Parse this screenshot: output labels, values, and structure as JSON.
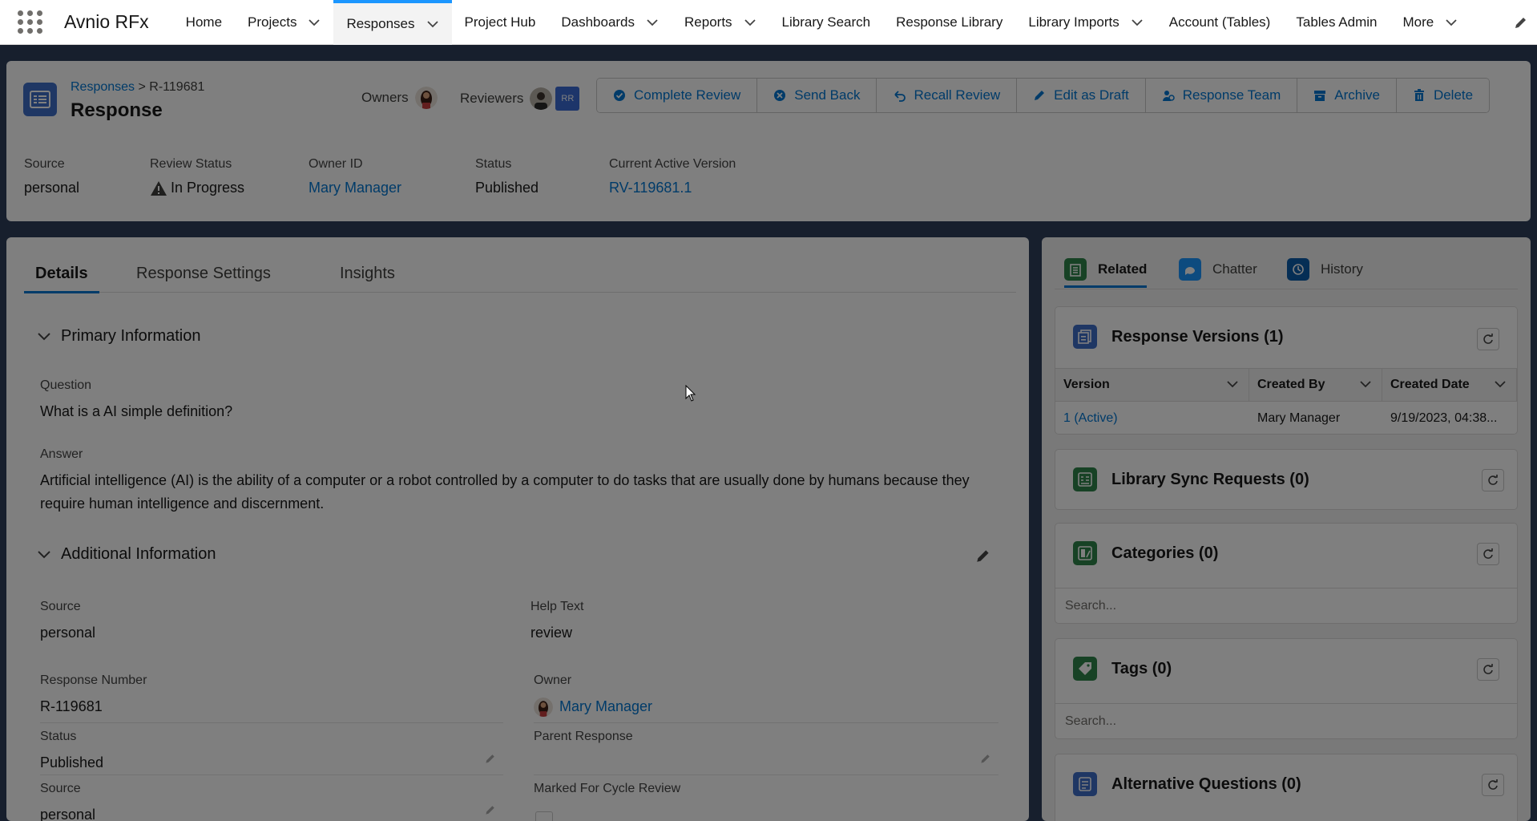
{
  "nav": {
    "app_name": "Avnio RFx",
    "items": [
      {
        "label": "Home",
        "chevron": false
      },
      {
        "label": "Projects",
        "chevron": true
      },
      {
        "label": "Responses",
        "chevron": true
      },
      {
        "label": "Project Hub",
        "chevron": false
      },
      {
        "label": "Dashboards",
        "chevron": true
      },
      {
        "label": "Reports",
        "chevron": true
      },
      {
        "label": "Library Search",
        "chevron": false
      },
      {
        "label": "Response Library",
        "chevron": false
      },
      {
        "label": "Library Imports",
        "chevron": true
      },
      {
        "label": "Account (Tables)",
        "chevron": false
      },
      {
        "label": "Tables Admin",
        "chevron": false
      },
      {
        "label": "More",
        "chevron": true
      }
    ],
    "active": "Responses"
  },
  "header": {
    "breadcrumb_link": "Responses",
    "breadcrumb_sep": ">",
    "breadcrumb_id": "R-119681",
    "title": "Response",
    "owners_label": "Owners",
    "reviewers_label": "Reviewers",
    "reviewer_initials": "RR",
    "actions": [
      {
        "label": "Complete Review",
        "icon": "check-circle-icon"
      },
      {
        "label": "Send Back",
        "icon": "close-circle-icon"
      },
      {
        "label": "Recall Review",
        "icon": "undo-icon"
      },
      {
        "label": "Edit as Draft",
        "icon": "pencil-icon"
      },
      {
        "label": "Response Team",
        "icon": "team-icon"
      },
      {
        "label": "Archive",
        "icon": "archive-icon"
      },
      {
        "label": "Delete",
        "icon": "trash-icon"
      }
    ],
    "highlights": {
      "source_label": "Source",
      "source_value": "personal",
      "review_status_label": "Review Status",
      "review_status_value": "In Progress",
      "owner_id_label": "Owner ID",
      "owner_id_value": "Mary Manager",
      "status_label": "Status",
      "status_value": "Published",
      "active_version_label": "Current Active Version",
      "active_version_value": "RV-119681.1"
    }
  },
  "main": {
    "tabs": [
      "Details",
      "Response Settings",
      "Insights"
    ],
    "active_tab": "Details",
    "primary_section": "Primary Information",
    "question_label": "Question",
    "question_value": "What is a AI simple definition?",
    "answer_label": "Answer",
    "answer_value": "Artificial intelligence (AI) is the ability of a computer or a robot controlled by a computer to do tasks that are usually done by humans because they require human intelligence and discernment.",
    "additional_section": "Additional Information",
    "source_label": "Source",
    "source_value": "personal",
    "help_text_label": "Help Text",
    "help_text_value": "review",
    "response_number_label": "Response Number",
    "response_number_value": "R-119681",
    "owner_label": "Owner",
    "owner_value": "Mary Manager",
    "status_label": "Status",
    "status_value": "Published",
    "parent_response_label": "Parent Response",
    "parent_response_value": "",
    "source2_label": "Source",
    "source2_value": "personal",
    "marked_cycle_label": "Marked For Cycle Review"
  },
  "side": {
    "tabs": [
      {
        "label": "Related",
        "icon": "related-icon",
        "color": "#2e844a"
      },
      {
        "label": "Chatter",
        "icon": "chatter-icon",
        "color": "#1b96ff"
      },
      {
        "label": "History",
        "icon": "history-icon",
        "color": "#0b5cab"
      }
    ],
    "active_tab": "Related",
    "versions_title": "Response Versions (1)",
    "versions_columns": [
      "Version",
      "Created By",
      "Created Date"
    ],
    "versions_rows": [
      {
        "version": "1 (Active)",
        "created_by": "Mary Manager",
        "created_date": "9/19/2023, 04:38..."
      }
    ],
    "sync_title": "Library Sync Requests (0)",
    "categories_title": "Categories (0)",
    "categories_search": "Search...",
    "tags_title": "Tags (0)",
    "tags_search": "Search...",
    "alt_title": "Alternative Questions (0)"
  },
  "colors": {
    "brand_blue": "#0176d3",
    "record_icon": "#3e6fc9",
    "green_icon": "#2e844a",
    "overlay": "rgba(0,0,0,0.5)"
  }
}
